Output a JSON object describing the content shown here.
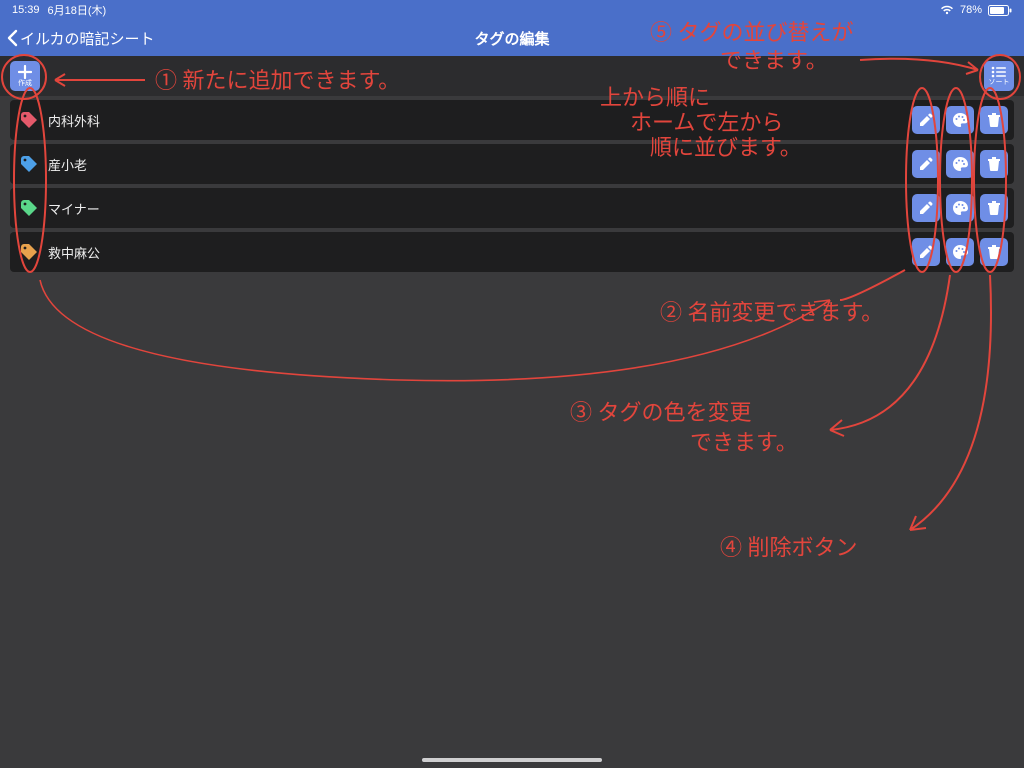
{
  "status": {
    "time": "15:39",
    "date": "6月18日(木)",
    "battery_pct": "78%"
  },
  "nav": {
    "back_label": "イルカの暗記シート",
    "title": "タグの編集"
  },
  "toolbar": {
    "create_btn_mini": "作成",
    "sort_btn_mini": "ソート"
  },
  "tags": [
    {
      "name": "内科外科",
      "color": "#e55a6b"
    },
    {
      "name": "産小老",
      "color": "#4da0e8"
    },
    {
      "name": "マイナー",
      "color": "#5ad78a"
    },
    {
      "name": "救中麻公",
      "color": "#e8a24d"
    }
  ],
  "annotations": {
    "n1": "① 新たに追加できます。",
    "n2_a": "② 名前変更できます。",
    "n3_a": "③ タグの色を変更",
    "n3_b": "できます。",
    "n4": "④ 削除ボタン",
    "n5_a": "⑤ タグの並び替えが",
    "n5_b": "できます。",
    "n6_a": "上から順に",
    "n6_b": "ホームで左から",
    "n6_c": "順に並びます。"
  },
  "colors": {
    "accent": "#6f8ee6",
    "navbar": "#4a6fc9",
    "annotation": "#e2453c"
  }
}
